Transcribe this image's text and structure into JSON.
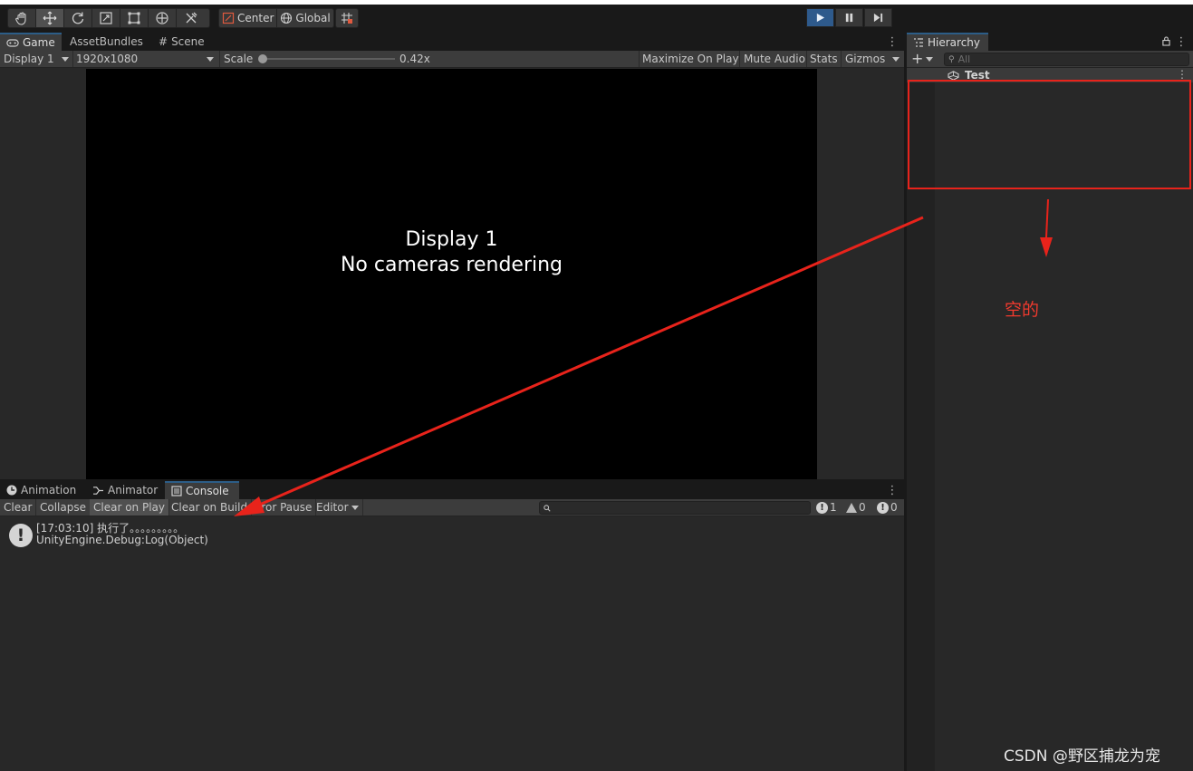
{
  "toolbar": {
    "pivot_label": "Center",
    "space_label": "Global"
  },
  "game_panel": {
    "tabs": [
      {
        "label": "Game"
      },
      {
        "label": "AssetBundles"
      },
      {
        "label": "Scene"
      }
    ],
    "display_select": "Display 1",
    "resolution_select": "1920x1080",
    "scale_label": "Scale",
    "scale_value": "0.42x",
    "scale_fraction": 0.0,
    "maximize_on_play": "Maximize On Play",
    "mute_audio": "Mute Audio",
    "stats": "Stats",
    "gizmos": "Gizmos",
    "canvas_line1": "Display 1",
    "canvas_line2": "No cameras rendering"
  },
  "console_panel": {
    "tabs": [
      {
        "label": "Animation"
      },
      {
        "label": "Animator"
      },
      {
        "label": "Console"
      }
    ],
    "buttons": {
      "clear": "Clear",
      "collapse": "Collapse",
      "clear_on_play": "Clear on Play",
      "clear_on_build": "Clear on Build",
      "error_pause": "Error Pause",
      "editor": "Editor"
    },
    "counts": {
      "log": "1",
      "warning": "0",
      "error": "0"
    },
    "log": {
      "line1": "[17:03:10] 执行了。。。。。。。。。",
      "line2": "UnityEngine.Debug:Log(Object)"
    }
  },
  "hierarchy_panel": {
    "tab_label": "Hierarchy",
    "search_placeholder": "All",
    "scene_name": "Test"
  },
  "annotations": {
    "note": "空的",
    "watermark": "CSDN @野区捕龙为宠",
    "color": "#e8231b"
  }
}
